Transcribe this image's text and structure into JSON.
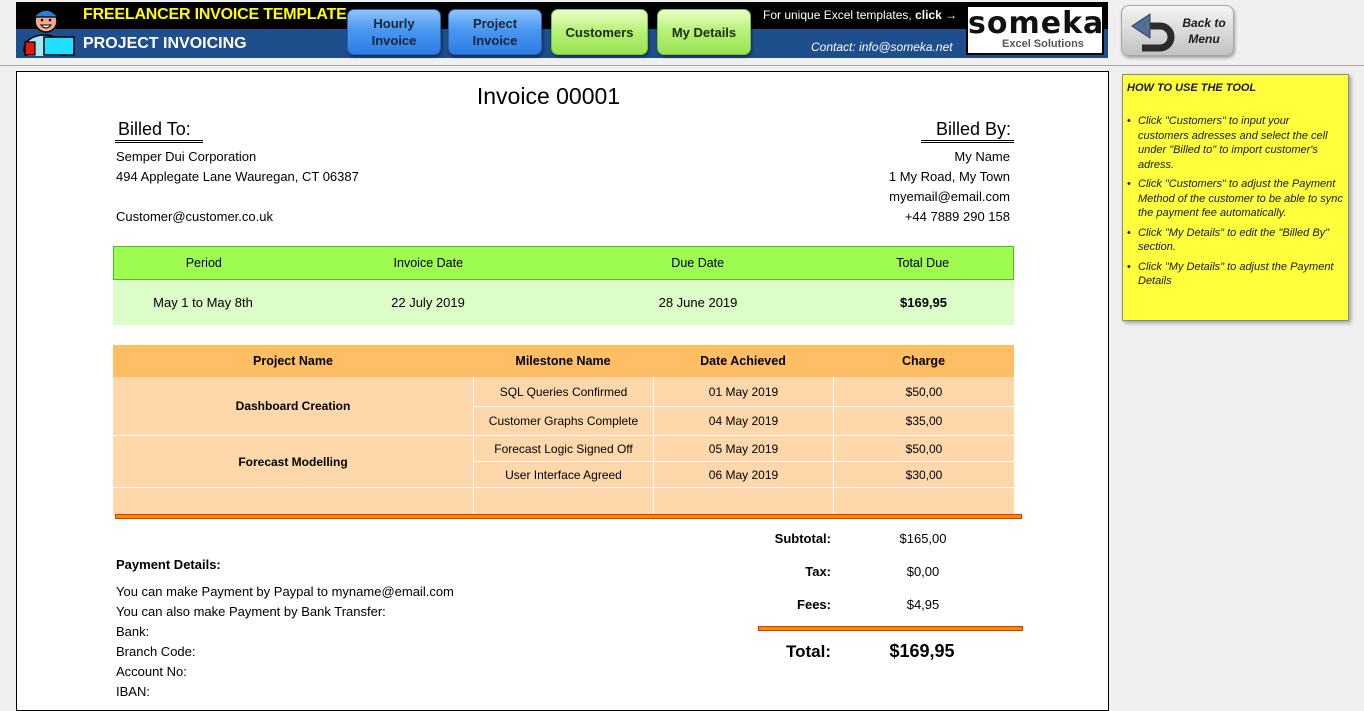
{
  "header": {
    "title_top": "FREELANCER INVOICE TEMPLATE",
    "title_bottom": "PROJECT INVOICING",
    "nav_buttons": [
      {
        "label_line1": "Hourly",
        "label_line2": "Invoice",
        "color": "#4b96f0"
      },
      {
        "label_line1": "Project",
        "label_line2": "Invoice",
        "color": "#4b96f0"
      },
      {
        "label": "Customers",
        "color": "#b9f27a"
      },
      {
        "label": "My Details",
        "color": "#b9f27a"
      }
    ],
    "promo_text": "For unique Excel templates, ",
    "promo_link": "click →",
    "contact": "Contact: info@someka.net",
    "logo_word": "someka",
    "logo_sub": "Excel Solutions",
    "back_button_line1": "Back to",
    "back_button_line2": "Menu",
    "banner_color": "#1f4e8c"
  },
  "invoice": {
    "title": "Invoice 00001",
    "billed_to": {
      "heading": "Billed To:",
      "name": "Semper Dui Corporation",
      "address": "494 Applegate Lane Wauregan, CT 06387",
      "blank": "",
      "email": "Customer@customer.co.uk"
    },
    "billed_by": {
      "heading": "Billed By:",
      "name": "My Name",
      "address": "1 My Road, My Town",
      "email": "myemail@email.com",
      "phone": "+44 7889 290 158"
    },
    "summary": {
      "headers": [
        "Period",
        "Invoice Date",
        "Due Date",
        "Total Due"
      ],
      "values": [
        "May 1 to May 8th",
        "22 July 2019",
        "28 June 2019",
        "$169,95"
      ],
      "header_color": "#9dfc4f",
      "row_color": "#dcfcc8"
    },
    "milestones": {
      "headers": [
        "Project Name",
        "Milestone Name",
        "Date Achieved",
        "Charge"
      ],
      "projects": [
        {
          "name": "Dashboard Creation",
          "items": [
            {
              "milestone": "SQL Queries Confirmed",
              "date": "01 May 2019",
              "charge": "$50,00"
            },
            {
              "milestone": "Customer Graphs Complete",
              "date": "04 May 2019",
              "charge": "$35,00"
            }
          ]
        },
        {
          "name": "Forecast Modelling",
          "items": [
            {
              "milestone": "Forecast Logic Signed Off",
              "date": "05 May 2019",
              "charge": "$50,00"
            },
            {
              "milestone": "User Interface Agreed",
              "date": "06 May 2019",
              "charge": "$30,00"
            }
          ]
        }
      ],
      "header_color": "#ffbe64",
      "row_color": "#fed8aa"
    },
    "totals": {
      "subtotal_label": "Subtotal:",
      "subtotal": "$165,00",
      "tax_label": "Tax:",
      "tax": "$0,00",
      "fees_label": "Fees:",
      "fees": "$4,95",
      "total_label": "Total:",
      "total": "$169,95"
    },
    "payment": {
      "heading": "Payment Details:",
      "lines": [
        "You can make Payment by Paypal to myname@email.com",
        "You can also make Payment by Bank Transfer:",
        "Bank:",
        "Branch Code:",
        "Account No:",
        "IBAN:"
      ]
    }
  },
  "help_panel": {
    "heading": "HOW TO USE THE TOOL",
    "items": [
      "Click \"Customers\" to input your customers adresses and select the cell under \"Billed to\" to import customer's adress.",
      "Click \"Customers\" to adjust the Payment Method of the customer to be able to sync the payment fee automatically.",
      "Click \"My Details\" to edit the \"Billed By\" section.",
      "Click \"My Details\" to adjust the Payment Details"
    ],
    "color": "#ffff3c"
  }
}
